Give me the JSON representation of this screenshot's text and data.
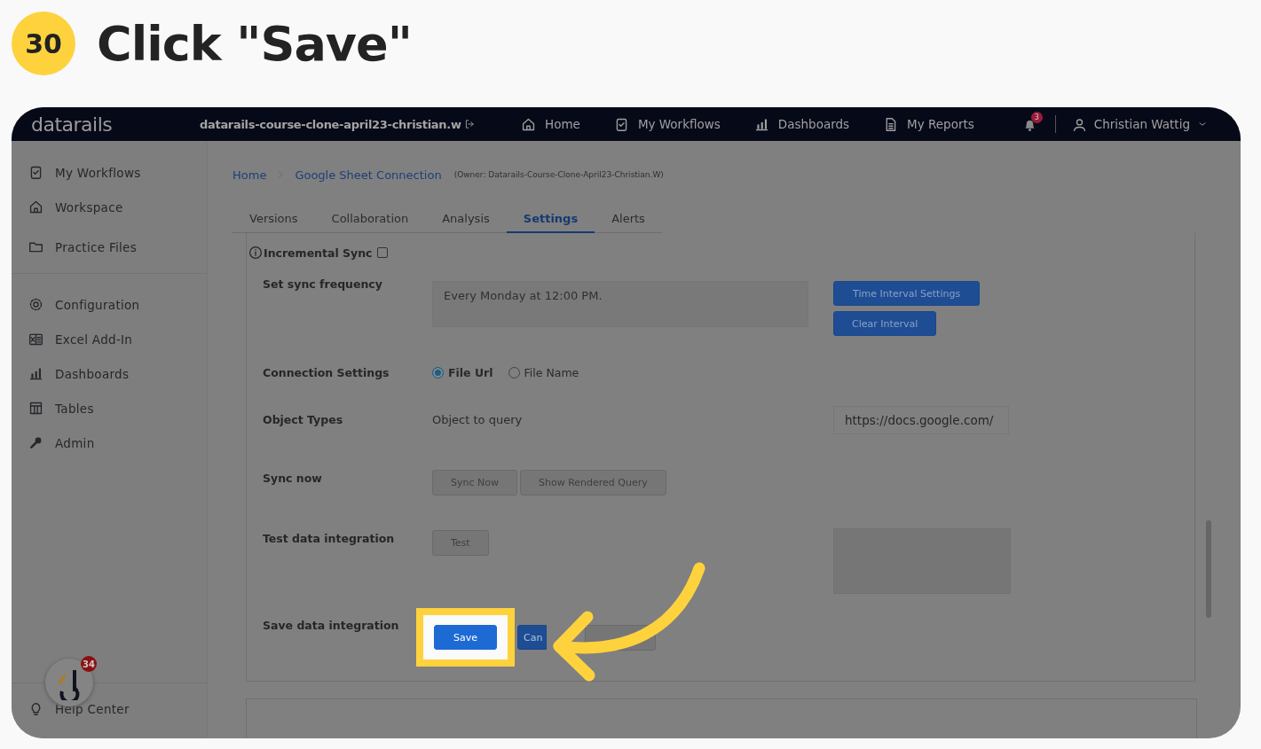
{
  "step": {
    "number": "30",
    "title": "Click \"Save\""
  },
  "navbar": {
    "logo": "datarails",
    "workspace": "datarails-course-clone-april23-christian.w",
    "links": [
      "Home",
      "My Workflows",
      "Dashboards",
      "My Reports"
    ],
    "notifications": "3",
    "user": "Christian Wattig"
  },
  "sidebar": {
    "groups": [
      [
        "My Workflows",
        "Workspace",
        "Practice Files"
      ],
      [
        "Configuration",
        "Excel Add-In",
        "Dashboards",
        "Tables",
        "Admin"
      ]
    ],
    "help": "Help Center",
    "widget_badge": "34"
  },
  "breadcrumb": {
    "items": [
      "Home",
      "Google Sheet Connection"
    ],
    "owner": "(Owner: Datarails-Course-Clone-April23-Christian.W)"
  },
  "tabs": [
    {
      "label": "Versions",
      "selected": false
    },
    {
      "label": "Collaboration",
      "selected": false
    },
    {
      "label": "Analysis",
      "selected": false
    },
    {
      "label": "Settings",
      "selected": true
    },
    {
      "label": "Alerts",
      "selected": false
    }
  ],
  "incremental_sync": {
    "label": "Incremental Sync",
    "checked": false
  },
  "rows": [
    {
      "kind": "frequency",
      "label": "Set sync frequency",
      "value": "Every Monday at 12:00 PM.",
      "buttons": [
        {
          "label": "Time Interval Settings",
          "kind": "primary"
        },
        {
          "label": "Clear Interval",
          "kind": "primary"
        }
      ]
    },
    {
      "kind": "radio",
      "label": "Connection Settings",
      "options": [
        {
          "label": "File Url",
          "selected": true
        },
        {
          "label": "File Name",
          "selected": false
        }
      ]
    },
    {
      "kind": "object",
      "label": "Object Types",
      "value": "Object to query",
      "url": "https://docs.google.com/"
    },
    {
      "kind": "buttons",
      "label": "Sync now",
      "buttons": [
        {
          "label": "Sync Now",
          "kind": "secondary"
        },
        {
          "label": "Show Rendered Query",
          "kind": "secondary"
        }
      ]
    },
    {
      "kind": "test",
      "label": "Test data integration",
      "buttons": [
        {
          "label": "Test",
          "kind": "secondary"
        }
      ]
    },
    {
      "kind": "save",
      "label": "Save data integration",
      "buttons": [
        {
          "label": "Save",
          "kind": "primary",
          "highlighted": true
        },
        {
          "label": "Can",
          "kind": "primary",
          "highlighted": false
        },
        {
          "kind": "secondary",
          "highlighted": false
        }
      ]
    }
  ]
}
